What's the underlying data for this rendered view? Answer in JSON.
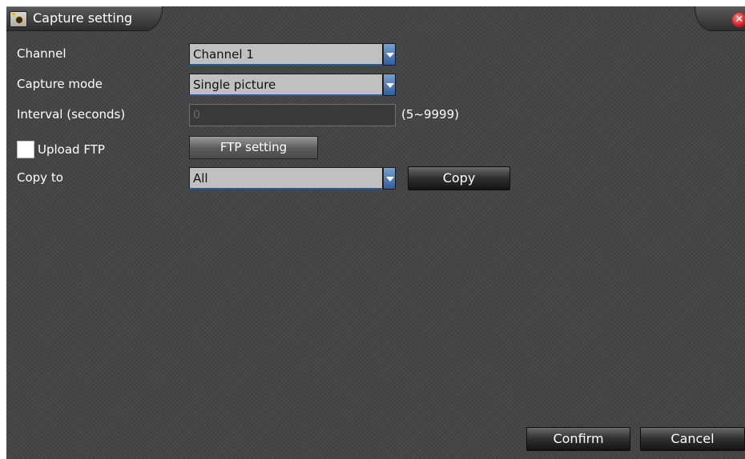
{
  "window": {
    "title": "Capture setting",
    "close_icon": "close-icon",
    "app_icon": "camera-icon"
  },
  "form": {
    "channel": {
      "label": "Channel",
      "value": "Channel 1"
    },
    "capture_mode": {
      "label": "Capture mode",
      "value": "Single picture"
    },
    "interval": {
      "label": "Interval (seconds)",
      "value": "0",
      "range": "(5~9999)",
      "disabled": true
    },
    "upload_ftp": {
      "label": "Upload FTP",
      "checked": false
    },
    "ftp_setting_button": "FTP setting",
    "copy_to": {
      "label": "Copy to",
      "value": "All"
    },
    "copy_button": "Copy"
  },
  "footer": {
    "confirm_label": "Confirm",
    "cancel_label": "Cancel"
  },
  "colors": {
    "background": "#454545",
    "combo_fill": "#c0c0c0",
    "combo_button": "#2f5f9f",
    "close_icon": "#d21e1e"
  }
}
